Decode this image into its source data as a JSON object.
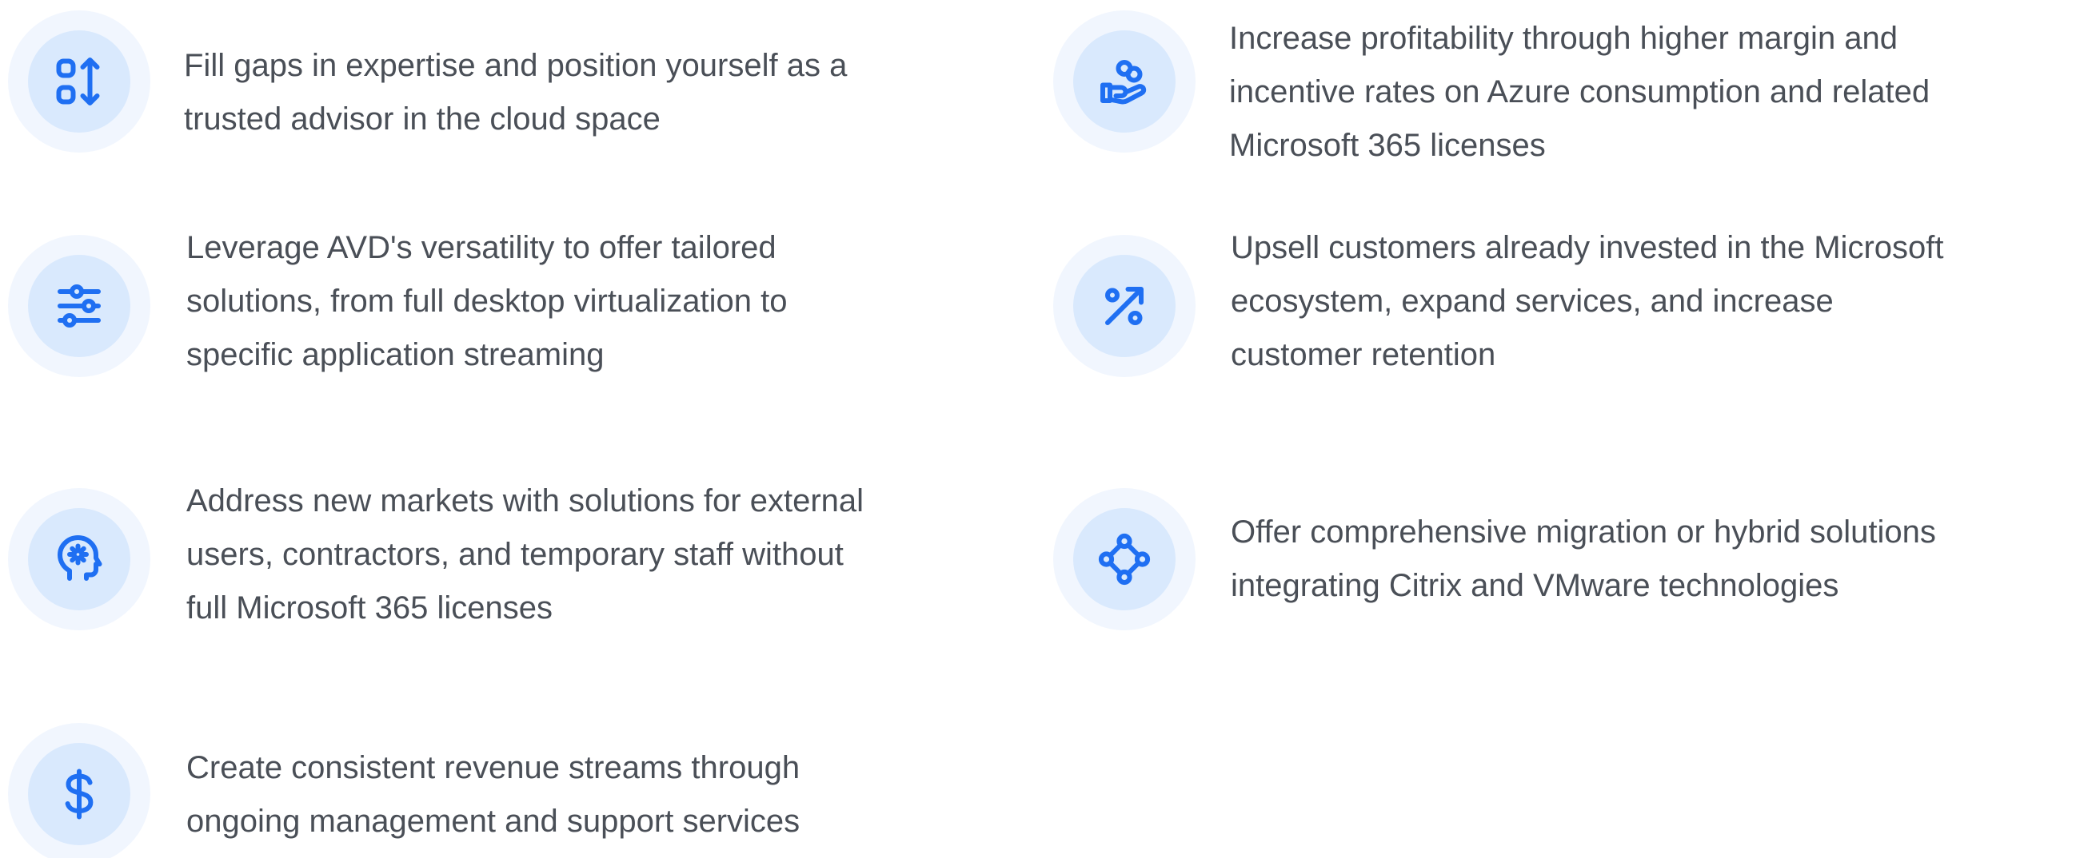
{
  "theme": {
    "accent": "#1f6ff2",
    "icon_ring_outer": "#f1f6fe",
    "icon_ring_inner": "#d9e9fd",
    "text_color": "#4a4f57"
  },
  "features": [
    {
      "icon": "expand-vertical-icon",
      "lines": [
        "Fill gaps in expertise and position yourself as a",
        "trusted advisor in the cloud space"
      ]
    },
    {
      "icon": "hand-coins-icon",
      "lines": [
        "Increase profitability through higher margin and",
        "incentive rates on Azure consumption and related",
        "Microsoft 365 licenses"
      ]
    },
    {
      "icon": "sliders-icon",
      "lines": [
        "Leverage AVD's versatility to offer tailored",
        "solutions, from full desktop virtualization to",
        "specific application streaming"
      ]
    },
    {
      "icon": "percent-trend-icon",
      "lines": [
        "Upsell customers already invested in the Microsoft",
        "ecosystem, expand services, and increase",
        "customer retention"
      ]
    },
    {
      "icon": "brain-gear-icon",
      "lines": [
        "Address new markets with solutions for external",
        "users, contractors, and temporary staff without",
        "full Microsoft 365 licenses"
      ]
    },
    {
      "icon": "network-nodes-icon",
      "lines": [
        "Offer comprehensive migration or hybrid solutions",
        "integrating Citrix and VMware technologies"
      ]
    },
    {
      "icon": "dollar-icon",
      "lines": [
        "Create consistent revenue streams through",
        "ongoing management and support services"
      ]
    }
  ]
}
